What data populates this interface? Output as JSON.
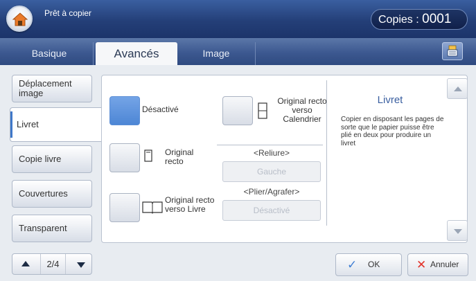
{
  "header": {
    "status": "Prêt à copier",
    "copies_label": "Copies :",
    "copies_value": "0001"
  },
  "tabs": [
    {
      "label": "Basique"
    },
    {
      "label": "Avancés"
    },
    {
      "label": "Image"
    }
  ],
  "nav": {
    "items": [
      {
        "label": "Déplacement image"
      },
      {
        "label": "Livret"
      },
      {
        "label": "Copie livre"
      },
      {
        "label": "Couvertures"
      },
      {
        "label": "Transparent"
      }
    ],
    "page": "2/4"
  },
  "options": {
    "off": "Désactivé",
    "recto": "Original recto",
    "recto_verso_livre": "Original recto verso Livre",
    "recto_verso_calendrier": "Original recto verso Calendrier",
    "reliure_title": "<Reliure>",
    "reliure_value": "Gauche",
    "plier_title": "<Plier/Agrafer>",
    "plier_value": "Désactivé"
  },
  "description": {
    "title": "Livret",
    "text": "Copier en disposant les pages de sorte que le papier puisse être plié en deux pour produire un livret"
  },
  "buttons": {
    "ok": "OK",
    "cancel": "Annuler"
  },
  "colors": {
    "header": "#243f78",
    "selected": "#5b8ed6",
    "accent": "#3a5fa0",
    "cancel": "#e2332a"
  }
}
